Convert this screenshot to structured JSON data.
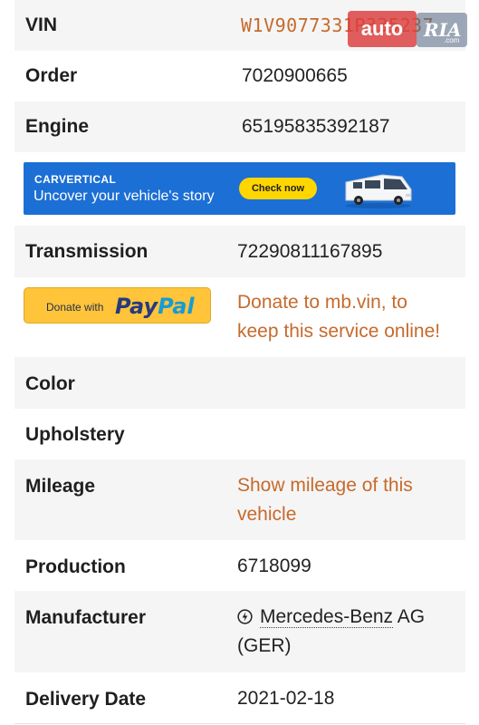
{
  "rows": {
    "vin": {
      "label": "VIN",
      "value": "W1V9077331P335237"
    },
    "order": {
      "label": "Order",
      "value": "7020900665"
    },
    "engine": {
      "label": "Engine",
      "value": "65195835392187"
    },
    "transmission": {
      "label": "Transmission",
      "value": "72290811167895"
    },
    "color": {
      "label": "Color"
    },
    "upholstery": {
      "label": "Upholstery"
    },
    "mileage": {
      "label": "Mileage",
      "line1": "Show mileage of this",
      "line2": "vehicle"
    },
    "production": {
      "label": "Production",
      "value": "6718099"
    },
    "manufacturer": {
      "label": "Manufacturer",
      "name": "Mercedes-Benz",
      "suffix": " AG",
      "line2": "(GER)"
    },
    "delivery": {
      "label": "Delivery Date",
      "value": "2021-02-18"
    }
  },
  "banner": {
    "logo": "CARVERTICAL",
    "text": "Uncover your vehicle's story",
    "button": "Check now"
  },
  "paypal": {
    "donate_with": "Donate with",
    "logo_a": "Pay",
    "logo_b": "Pal",
    "line1": "Donate to mb.vin, to",
    "line2": "keep this service online!"
  },
  "watermark": {
    "auto": "auto",
    "ria": "RIA",
    "com": ".com"
  },
  "icons": {
    "manufacturer": "bolt-circle-icon"
  },
  "colors": {
    "accent": "#c66a2c",
    "banner": "#1c6fd4",
    "cta_yellow": "#ffd600",
    "paypal_yellow": "#ffc439"
  }
}
